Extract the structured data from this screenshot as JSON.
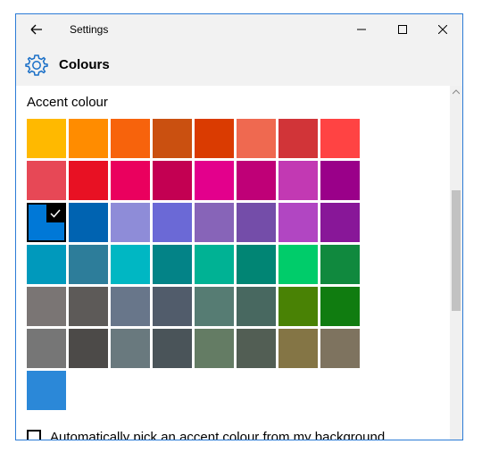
{
  "window": {
    "title": "Settings"
  },
  "header": {
    "title": "Colours"
  },
  "accent": {
    "section_title": "Accent colour",
    "selected_color": "#0078D7",
    "colors": [
      [
        "#FFB900",
        "#FF8C00",
        "#F7630C",
        "#CA5010",
        "#DA3B01",
        "#EF6950",
        "#D13438",
        "#FF4343"
      ],
      [
        "#E74856",
        "#E81123",
        "#EA005E",
        "#C30052",
        "#E3008C",
        "#BF0077",
        "#C239B3",
        "#9A0089"
      ],
      [
        "#0078D7",
        "#0063B1",
        "#8E8CD8",
        "#6B69D6",
        "#8764B8",
        "#744DA9",
        "#B146C2",
        "#881798"
      ],
      [
        "#0099BC",
        "#2D7D9A",
        "#00B7C3",
        "#038387",
        "#00B294",
        "#018574",
        "#00CC6A",
        "#10893E"
      ],
      [
        "#7A7574",
        "#5D5A58",
        "#68768A",
        "#515C6B",
        "#567C73",
        "#486860",
        "#498205",
        "#107C10"
      ],
      [
        "#767676",
        "#4C4A48",
        "#69797E",
        "#4A5459",
        "#647C64",
        "#525E54",
        "#847545",
        "#7E735F"
      ],
      [
        "#2B88D8"
      ]
    ],
    "auto_pick_label": "Automatically pick an accent colour from my background",
    "auto_pick_checked": false
  }
}
